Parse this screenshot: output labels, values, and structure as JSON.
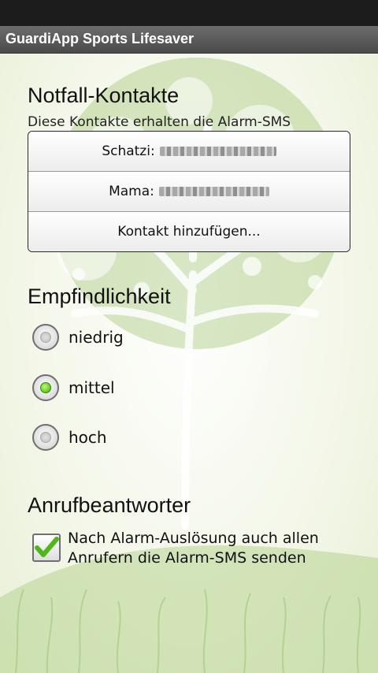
{
  "app": {
    "title": "GuardiApp Sports Lifesaver"
  },
  "contacts_section": {
    "heading": "Notfall-Kontakte",
    "subtitle": "Diese Kontakte erhalten die Alarm-SMS",
    "contacts": [
      {
        "label": "Schatzi:"
      },
      {
        "label": "Mama:"
      }
    ],
    "add_label": "Kontakt hinzufügen..."
  },
  "sensitivity": {
    "heading": "Empfindlichkeit",
    "options": [
      {
        "label": "niedrig",
        "selected": false
      },
      {
        "label": "mittel",
        "selected": true
      },
      {
        "label": "hoch",
        "selected": false
      }
    ]
  },
  "answering_machine": {
    "heading": "Anrufbeantworter",
    "checkbox_label": "Nach Alarm-Auslösung auch allen Anrufern die Alarm-SMS senden",
    "checked": true
  },
  "colors": {
    "accent_green": "#5cc21a",
    "titlebar": "#5a5a5a",
    "art": "#9bc36e"
  }
}
